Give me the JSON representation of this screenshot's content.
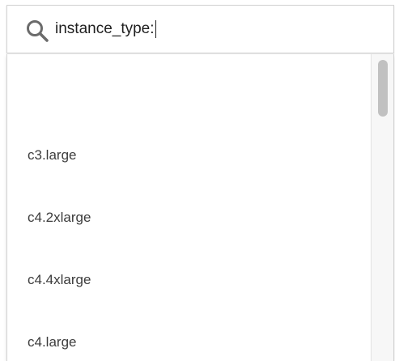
{
  "search": {
    "icon": "search-icon",
    "value": "instance_type:"
  },
  "dropdown": {
    "options": [
      {
        "label": ""
      },
      {
        "label": "c3.large"
      },
      {
        "label": "c4.2xlarge"
      },
      {
        "label": "c4.4xlarge"
      },
      {
        "label": "c4.large"
      }
    ]
  },
  "colors": {
    "border": "#d3d3d3",
    "text": "#1f1f1f",
    "option_text": "#3c3c3c",
    "icon": "#6b6b6b",
    "scroll_thumb": "#c1c1c1"
  }
}
